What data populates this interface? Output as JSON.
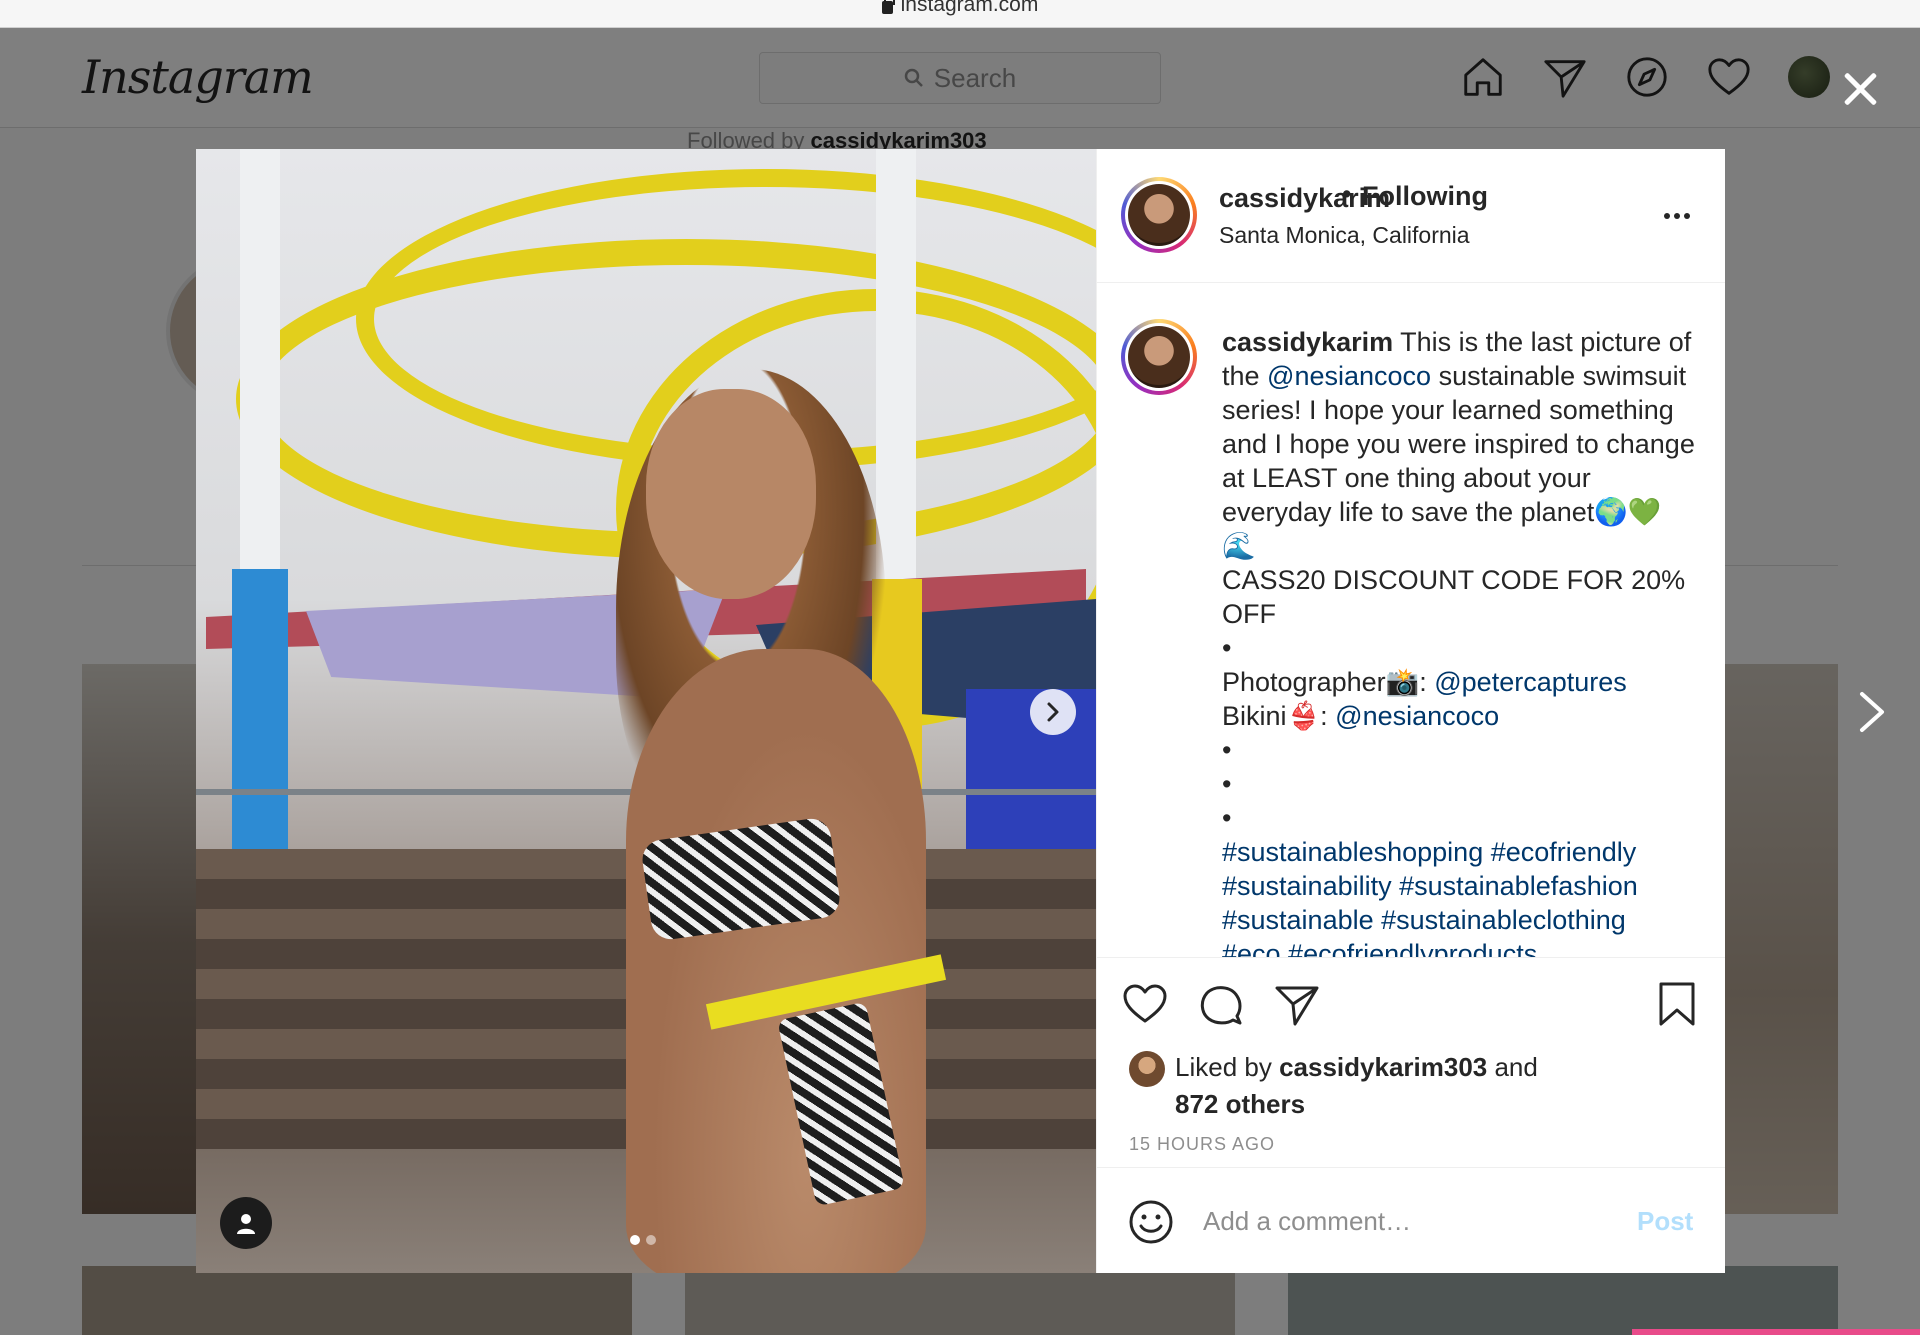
{
  "browser": {
    "url": "instagram.com"
  },
  "header": {
    "logo": "Instagram",
    "search_placeholder": "Search",
    "nav_icons": [
      "home-icon",
      "direct-icon",
      "explore-icon",
      "activity-icon",
      "profile-avatar"
    ]
  },
  "background": {
    "followed_by_prefix": "Followed by",
    "followed_by_user": "cassidykarim303"
  },
  "post": {
    "username": "cassidykarim",
    "separator": "•",
    "follow_status": "Following",
    "location": "Santa Monica, California",
    "carousel": {
      "current": 1,
      "total": 2
    },
    "caption": {
      "user": "cassidykarim",
      "text1": " This is the last picture of the ",
      "mention1": "@nesiancoco",
      "text2": " sustainable swimsuit series! I hope your learned something and I hope you were inspired to change at LEAST one thing about your everyday life to save the planet🌍💚",
      "wave": "🌊",
      "discount": "CASS20 DISCOUNT CODE FOR 20% OFF",
      "bullet": "•",
      "photographer_label": "Photographer📸: ",
      "photographer": "@petercaptures",
      "bikini_label": "Bikini👙: ",
      "bikini": "@nesiancoco",
      "hashtags1": "#sustainableshopping #ecofriendly",
      "hashtags2": "#sustainability #sustainablefashion",
      "hashtags3": "#sustainable #sustainableclothing",
      "hashtags4": "#eco #ecofriendlyproducts"
    },
    "likes": {
      "prefix": "Liked by ",
      "user": "cassidykarim303",
      "suffix": " and",
      "others": "872 others"
    },
    "time_ago": "15 HOURS AGO",
    "comment_placeholder": "Add a comment…",
    "post_button": "Post"
  },
  "colors": {
    "link": "#00376b",
    "post_disabled": "#b2dffc",
    "overlay": "rgba(0,0,0,0.5)"
  }
}
